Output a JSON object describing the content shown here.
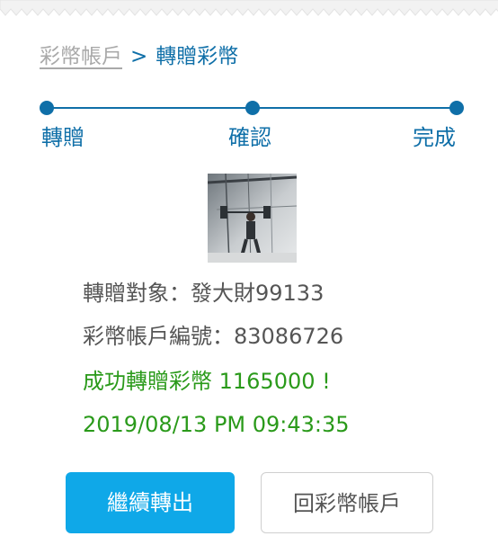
{
  "breadcrumb": {
    "parent": "彩幣帳戶",
    "separator": ">",
    "current": "轉贈彩幣"
  },
  "steps": [
    {
      "label": "轉贈"
    },
    {
      "label": "確認"
    },
    {
      "label": "完成"
    }
  ],
  "info": {
    "recipient": "轉贈對象：發大財99133",
    "account": "彩幣帳戶編號：83086726",
    "success": "成功轉贈彩幣 1165000 !",
    "timestamp": "2019/08/13 PM 09:43:35"
  },
  "actions": {
    "continue_label": "繼續轉出",
    "back_label": "回彩幣帳戶"
  },
  "colors": {
    "primary": "#0f6fa8",
    "button": "#0fa8e8",
    "success": "#2a9a1a"
  }
}
